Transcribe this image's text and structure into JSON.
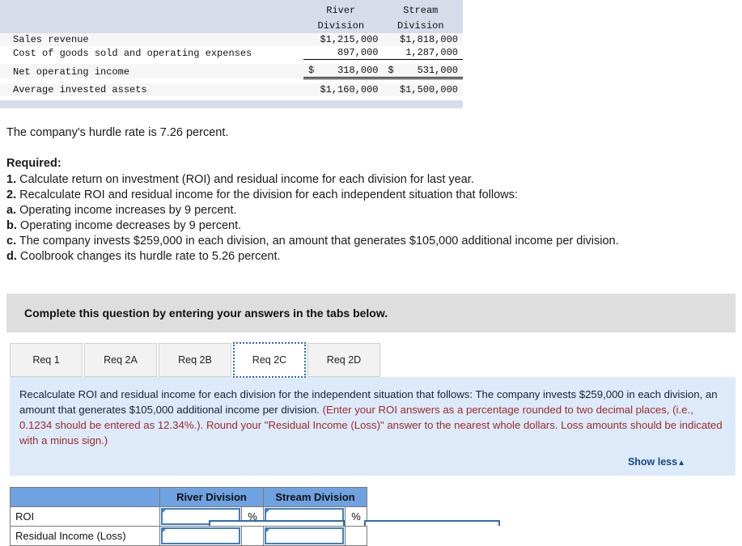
{
  "fin_table": {
    "headers": [
      "",
      "River Division",
      "Stream Division"
    ],
    "header_lines": {
      "col1_line1": "River",
      "col1_line2": "Division",
      "col2_line1": "Stream",
      "col2_line2": "Division"
    },
    "rows": [
      {
        "label": "Sales revenue",
        "river": "$1,215,000",
        "stream": "$1,818,000"
      },
      {
        "label": "Cost of goods sold and operating expenses",
        "river": "897,000",
        "stream": "1,287,000"
      },
      {
        "label": "Net operating income",
        "river_sym": "$",
        "river": "318,000",
        "stream_sym": "$",
        "stream": "531,000"
      },
      {
        "label": "Average invested assets",
        "river": "$1,160,000",
        "stream": "$1,500,000"
      }
    ]
  },
  "hurdle_text": "The company's hurdle rate is 7.26 percent.",
  "required": {
    "heading": "Required:",
    "items": [
      {
        "marker": "1.",
        "text": " Calculate return on investment (ROI) and residual income for each division for last year."
      },
      {
        "marker": "2.",
        "text": " Recalculate ROI and residual income for the division for each independent situation that follows:"
      },
      {
        "marker": "a.",
        "text": " Operating income increases by 9 percent."
      },
      {
        "marker": "b.",
        "text": " Operating income decreases by 9 percent."
      },
      {
        "marker": "c.",
        "text": " The company invests $259,000 in each division, an amount that generates $105,000 additional income per division."
      },
      {
        "marker": "d.",
        "text": " Coolbrook changes its hurdle rate to 5.26 percent."
      }
    ]
  },
  "banner": {
    "text": "Complete this question by entering your answers in the tabs below."
  },
  "tabs": [
    {
      "label": "Req 1",
      "active": false
    },
    {
      "label": "Req 2A",
      "active": false
    },
    {
      "label": "Req 2B",
      "active": false
    },
    {
      "label": "Req 2C",
      "active": true
    },
    {
      "label": "Req 2D",
      "active": false
    }
  ],
  "instruction_panel": {
    "black_part": "Recalculate ROI and residual income for each division for the independent situation that follows: The company invests $259,000 in each division, an amount that generates $105,000 additional income per division. ",
    "red_part": "(Enter your ROI answers as a percentage rounded to two decimal places, (i.e., 0.1234 should be entered as 12.34%.). Round your \"Residual Income (Loss)\" answer to the nearest whole dollars. Loss amounts should be indicated with a minus sign.)",
    "show_less_label": "Show less",
    "show_less_arrow": "▲"
  },
  "answer_table": {
    "column_headers": [
      "",
      "River Division",
      "Stream Division"
    ],
    "rows": [
      {
        "label": "ROI",
        "river_value": "",
        "river_suffix": "%",
        "stream_value": "",
        "stream_suffix": "%"
      },
      {
        "label": "Residual Income (Loss)",
        "river_value": "",
        "river_suffix": "",
        "stream_value": "",
        "stream_suffix": ""
      }
    ]
  },
  "colors": {
    "table_header_bg": "#d6dce9",
    "banner_bg": "#dedede",
    "panel_bg": "#ddeafa",
    "answer_header_blue": "#6fa2e0",
    "input_border_blue": "#3f7ec4",
    "red_text": "#9c2a2a",
    "link_blue": "#16458c",
    "tab_focus_blue": "#2b6cb8"
  }
}
